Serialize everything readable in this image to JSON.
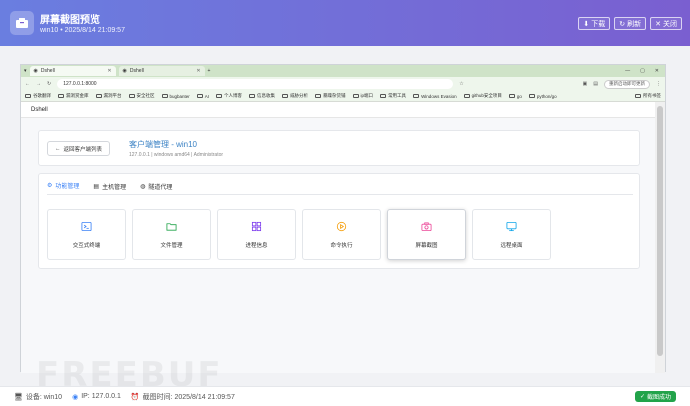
{
  "modal": {
    "title": "屏幕截图预览",
    "subtitle": "win10 • 2025/8/14 21:09:57",
    "buttons": {
      "download": "下载",
      "refresh": "刷新",
      "close": "关闭"
    }
  },
  "browser": {
    "tabs": [
      {
        "label": "Dshell",
        "active": true
      },
      {
        "label": "Dshell",
        "active": false
      }
    ],
    "url": "127.0.0.1:8000",
    "update_label": "重新启动即可更新",
    "bookmarks": [
      "谷歌翻译",
      "漏洞赏金库",
      "漏洞平台",
      "安全社区",
      "bugbanter",
      "AI",
      "个人博客",
      "信息收集",
      "威胁分析",
      "暴躁杂货铺",
      "ip端口",
      "常用工具",
      "Windows Evasion",
      "github安全项目",
      "go",
      "python/go"
    ],
    "bookmarks_right": "所有书签"
  },
  "page": {
    "app_name": "Dshell",
    "back_label": "返回客户端列表",
    "title": "客户端管理 - win10",
    "subtitle": "127.0.0.1 | windows amd64 | Administrator",
    "tabs": [
      "功能管理",
      "主机管理",
      "隧道代理"
    ],
    "tiles": [
      {
        "label": "交互式终端",
        "color": "#3b82f6",
        "icon": "terminal-icon"
      },
      {
        "label": "文件管理",
        "color": "#22a34a",
        "icon": "folder-icon"
      },
      {
        "label": "进程信息",
        "color": "#7c3aed",
        "icon": "grid-icon"
      },
      {
        "label": "命令执行",
        "color": "#f59e0b",
        "icon": "play-circle-icon"
      },
      {
        "label": "屏幕截图",
        "color": "#ec4899",
        "icon": "camera-icon"
      },
      {
        "label": "远程桌面",
        "color": "#0ea5e9",
        "icon": "monitor-icon"
      }
    ]
  },
  "footer": {
    "device": "设备: win10",
    "ip": "IP: 127.0.0.1",
    "time": "截图时间: 2025/8/14 21:09:57",
    "status": "截图成功"
  },
  "watermark": "FREEBUF"
}
